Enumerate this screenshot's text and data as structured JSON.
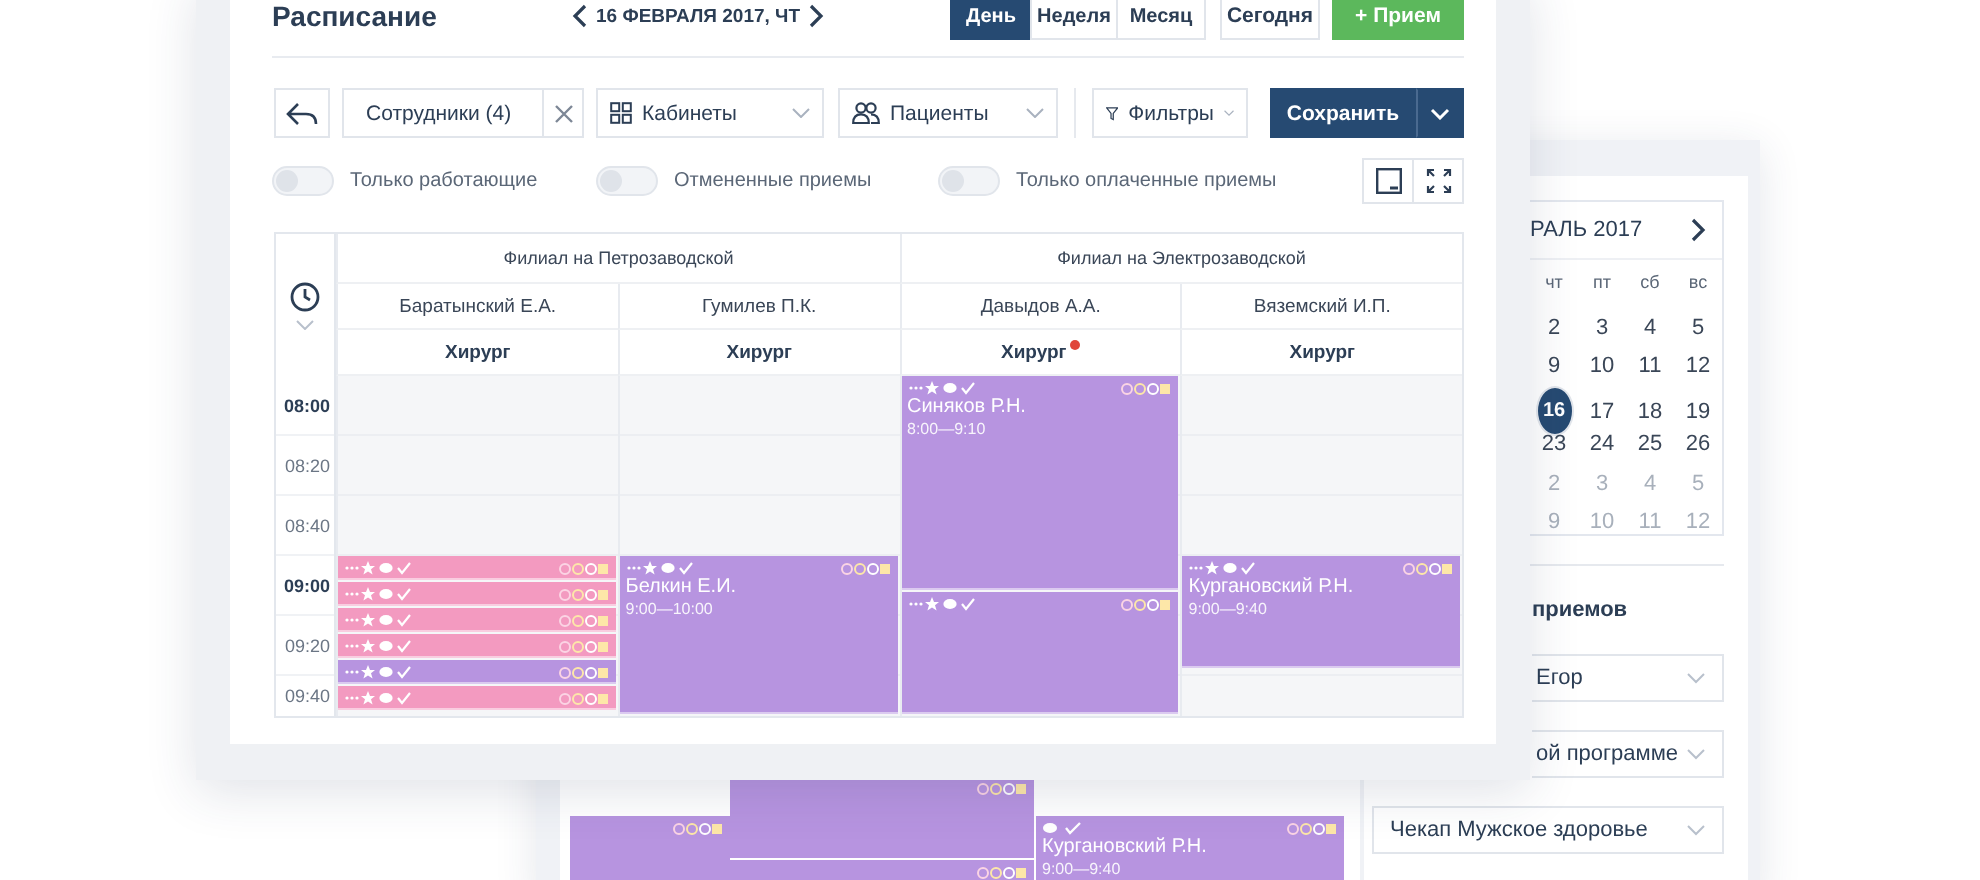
{
  "schedule": {
    "title": "Расписание",
    "date": "16 ФЕВРАЛЯ 2017, ЧТ",
    "views": [
      {
        "label": "День",
        "selected": true
      },
      {
        "label": "Неделя",
        "selected": false
      },
      {
        "label": "Месяц",
        "selected": false
      }
    ],
    "today_button": "Сегодня",
    "add_button": "+ Прием"
  },
  "toolbar": {
    "filters": [
      {
        "label": "Сотрудники (4)",
        "clearable": true
      },
      {
        "label": "Кабинеты",
        "clearable": false
      },
      {
        "label": "Пациенты",
        "clearable": false
      }
    ],
    "filter_button": "Фильтры",
    "save_button": "Сохранить"
  },
  "toggles": [
    {
      "label": "Только работающие",
      "on": false
    },
    {
      "label": "Отмененные приемы",
      "on": false
    },
    {
      "label": "Только оплаченные приемы",
      "on": false
    }
  ],
  "grid": {
    "times": [
      {
        "label": "08:00",
        "full_hour": true
      },
      {
        "label": "08:20",
        "full_hour": false
      },
      {
        "label": "08:40",
        "full_hour": false
      },
      {
        "label": "09:00",
        "full_hour": true
      },
      {
        "label": "09:20",
        "full_hour": false
      },
      {
        "label": "09:40",
        "full_hour": false
      }
    ],
    "branches": [
      {
        "name": "Филиал на Петрозаводской",
        "doctors": [
          {
            "name": "Баратынский Е.А.",
            "role": "Хирург",
            "notification": false,
            "appointments": [
              {
                "color": "#f39ac0"
              },
              {
                "color": "#f39ac0"
              },
              {
                "color": "#f39ac0"
              },
              {
                "color": "#f39ac0"
              },
              {
                "color": "#b794e0"
              },
              {
                "color": "#f39ac0"
              }
            ]
          },
          {
            "name": "Гумилев П.К.",
            "role": "Хирург",
            "notification": false,
            "appointments": [
              {
                "color": "#b794e0",
                "patient": "Белкин Е.И.",
                "time": "9:00—10:00"
              }
            ]
          }
        ]
      },
      {
        "name": "Филиал на Электрозаводской",
        "doctors": [
          {
            "name": "Давыдов А.А.",
            "role": "Хирург",
            "notification": true,
            "appointments": [
              {
                "color": "#b794e0",
                "patient": "Синяков Р.Н.",
                "time": "8:00—9:10"
              },
              {
                "color": "#b794e0"
              }
            ]
          },
          {
            "name": "Вяземский И.П.",
            "role": "Хирург",
            "notification": false,
            "appointments": [
              {
                "color": "#b794e0",
                "patient": "Кургановский Р.Н.",
                "time": "9:00—9:40"
              }
            ]
          }
        ]
      }
    ]
  },
  "back_window": {
    "appointments": [
      {
        "color": "#b794e0"
      },
      {
        "color": "#b794e0"
      },
      {
        "color": "#b794e0"
      },
      {
        "color": "#b794e0",
        "patient": "Кургановский Р.Н.",
        "time": "9:00—9:40"
      }
    ],
    "calendar": {
      "month": "РАЛЬ 2017",
      "weekdays": [
        "чт",
        "пт",
        "сб",
        "вс"
      ],
      "weeks": [
        [
          {
            "day": "2",
            "selected": false,
            "other_month": false
          },
          {
            "day": "3",
            "selected": false,
            "other_month": false
          },
          {
            "day": "4",
            "selected": false,
            "other_month": false
          },
          {
            "day": "5",
            "selected": false,
            "other_month": false
          }
        ],
        [
          {
            "day": "9",
            "selected": false,
            "other_month": false
          },
          {
            "day": "10",
            "selected": false,
            "other_month": false
          },
          {
            "day": "11",
            "selected": false,
            "other_month": false
          },
          {
            "day": "12",
            "selected": false,
            "other_month": false
          }
        ],
        [
          {
            "day": "16",
            "selected": true,
            "other_month": false
          },
          {
            "day": "17",
            "selected": false,
            "other_month": false
          },
          {
            "day": "18",
            "selected": false,
            "other_month": false
          },
          {
            "day": "19",
            "selected": false,
            "other_month": false
          }
        ],
        [
          {
            "day": "23",
            "selected": false,
            "other_month": false
          },
          {
            "day": "24",
            "selected": false,
            "other_month": false
          },
          {
            "day": "25",
            "selected": false,
            "other_month": false
          },
          {
            "day": "26",
            "selected": false,
            "other_month": false
          }
        ],
        [
          {
            "day": "2",
            "selected": false,
            "other_month": true
          },
          {
            "day": "3",
            "selected": false,
            "other_month": true
          },
          {
            "day": "4",
            "selected": false,
            "other_month": true
          },
          {
            "day": "5",
            "selected": false,
            "other_month": true
          }
        ],
        [
          {
            "day": "9",
            "selected": false,
            "other_month": true
          },
          {
            "day": "10",
            "selected": false,
            "other_month": true
          },
          {
            "day": "11",
            "selected": false,
            "other_month": true
          },
          {
            "day": "12",
            "selected": false,
            "other_month": true
          }
        ]
      ]
    },
    "section_title": "приемов",
    "selects": [
      "Егор",
      "ой программе",
      "Чекап Мужское здоровье"
    ]
  }
}
